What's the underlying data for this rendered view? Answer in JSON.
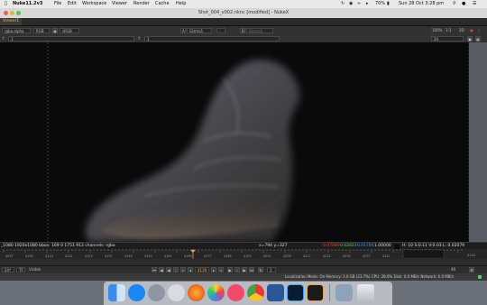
{
  "menubar": {
    "app": "Nuke11.2v3",
    "items": [
      "File",
      "Edit",
      "Workspace",
      "Viewer",
      "Render",
      "Cache",
      "Help"
    ],
    "battery": "70%",
    "datetime": "Sun 28 Oct  3:28 pm"
  },
  "window": {
    "title": "Shot_004_v002.nknc [modified] - NukeX"
  },
  "viewer_tab": {
    "label": "Viewer1"
  },
  "toolbar1": {
    "channels": "rgba.alpha",
    "colorspace": "RGB",
    "lut": "sRGB",
    "input_a": "A",
    "gizmo_a": "Gizmo1",
    "dash": "-",
    "input_b": "B",
    "gizmo_b": "Gizmo1",
    "zoom": "100%",
    "ratio": "1:1",
    "mode": "2D"
  },
  "toolbar2": {
    "f_label": "f",
    "f_value": "1",
    "y_label": "Y",
    "y_value": "1",
    "right_value": "20"
  },
  "infobar": {
    "format": "_1080 1920x1080  bbox: 169 0 1751 912 channels: rgba",
    "coords": "x=794 y=327",
    "r": "0.07080",
    "g": "0.02823",
    "b": "0.01784",
    "a": "1.00000",
    "hsvl": "H: 10 S:0.11 V:0.03  L: 0.02079"
  },
  "timeline": {
    "ticks": [
      "4097",
      "4105",
      "4113",
      "4121",
      "4129",
      "4137",
      "4145",
      "4153",
      "4161",
      "4169",
      "4177",
      "4185",
      "4193",
      "4201",
      "4209",
      "4217",
      "4225",
      "4233",
      "4237",
      "4241",
      "4247"
    ],
    "end_frame": "4152"
  },
  "playback": {
    "fps": "24*",
    "tf": "TF",
    "mode": "Visible",
    "current_frame": "4139",
    "step": "1",
    "range_end": "46"
  },
  "statusbar": {
    "text": "Localization Mode: On  Memory: 3.0 GB (23.7%)  CPU: 28.6%  Disk: 0.0 MB/s  Network: 0.0 MB/s"
  },
  "dock": {
    "apps": [
      "finder",
      "safari",
      "launchpad",
      "rocket",
      "firefox",
      "photos",
      "itunes",
      "chrome",
      "word",
      "photoshop",
      "nuke",
      "preview",
      "trash"
    ]
  },
  "colors": {
    "accent": "#e8a33c",
    "r": "#e24a3b",
    "g": "#4fd16b",
    "b": "#4c8df0"
  }
}
